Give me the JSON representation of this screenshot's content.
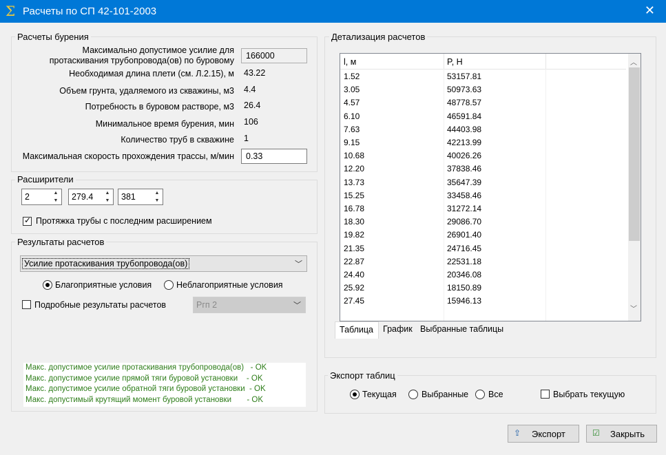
{
  "window": {
    "title": "Расчеты по СП 42-101-2003"
  },
  "drilling": {
    "group_label": "Расчеты бурения",
    "max_force_label": "Максимально допустимое усилие для протаскивания трубопровода(ов) по буровому",
    "max_force_value": "166000",
    "length_label": "Необходимая длина плети (см. Л.2.15), м",
    "length_value": "43.22",
    "soil_label": "Объем грунта, удаляемого из скважины, м3",
    "soil_value": "4.4",
    "mud_label": "Потребность в буровом растворе, м3",
    "mud_value": "26.4",
    "time_label": "Минимальное время бурения, мин",
    "time_value": "106",
    "pipes_label": "Количество труб в скважине",
    "pipes_value": "1",
    "speed_label": "Максимальная скорость прохождения трассы, м/мин",
    "speed_value": "0.33"
  },
  "reamers": {
    "group_label": "Расширители",
    "spin1": "2",
    "spin2": "279.4",
    "spin3": "381",
    "pull_label": "Протяжка трубы с последним расширением",
    "pull_checked": true
  },
  "results": {
    "group_label": "Результаты расчетов",
    "combo_value": "Усилие протаскивания трубопровода(ов)",
    "radio_favorable": "Благоприятные условия",
    "radio_unfavorable": "Неблагоприятные условия",
    "selected_radio": "favorable",
    "detailed_label": "Подробные результаты расчетов",
    "detailed_checked": false,
    "detailed_combo": "Ргп 2",
    "checks": [
      "Макс. допустимое усилие протаскивания трубопровода(ов)   - OK",
      "Макс. допустимое усилие прямой тяги буровой установки    - OK",
      "Макс. допустимое усилие обратной тяги буровой установки  - OK",
      "Макс. допустимый крутящий момент буровой установки       - OK"
    ]
  },
  "detail": {
    "group_label": "Детализация расчетов",
    "columns": [
      "l, м",
      "P, Н"
    ],
    "rows": [
      [
        "1.52",
        "53157.81"
      ],
      [
        "3.05",
        "50973.63"
      ],
      [
        "4.57",
        "48778.57"
      ],
      [
        "6.10",
        "46591.84"
      ],
      [
        "7.63",
        "44403.98"
      ],
      [
        "9.15",
        "42213.99"
      ],
      [
        "10.68",
        "40026.26"
      ],
      [
        "12.20",
        "37838.46"
      ],
      [
        "13.73",
        "35647.39"
      ],
      [
        "15.25",
        "33458.46"
      ],
      [
        "16.78",
        "31272.14"
      ],
      [
        "18.30",
        "29086.70"
      ],
      [
        "19.82",
        "26901.40"
      ],
      [
        "21.35",
        "24716.45"
      ],
      [
        "22.87",
        "22531.18"
      ],
      [
        "24.40",
        "20346.08"
      ],
      [
        "25.92",
        "18150.89"
      ],
      [
        "27.45",
        "15946.13"
      ]
    ],
    "tabs": [
      "Таблица",
      "График",
      "Выбранные таблицы"
    ],
    "active_tab": 0
  },
  "export": {
    "group_label": "Экспорт таблиц",
    "radio_current": "Текущая",
    "radio_selected": "Выбранные",
    "radio_all": "Все",
    "selected_radio": "current",
    "select_current_label": "Выбрать текущую",
    "select_current_checked": false
  },
  "buttons": {
    "export": "Экспорт",
    "close": "Закрыть"
  }
}
